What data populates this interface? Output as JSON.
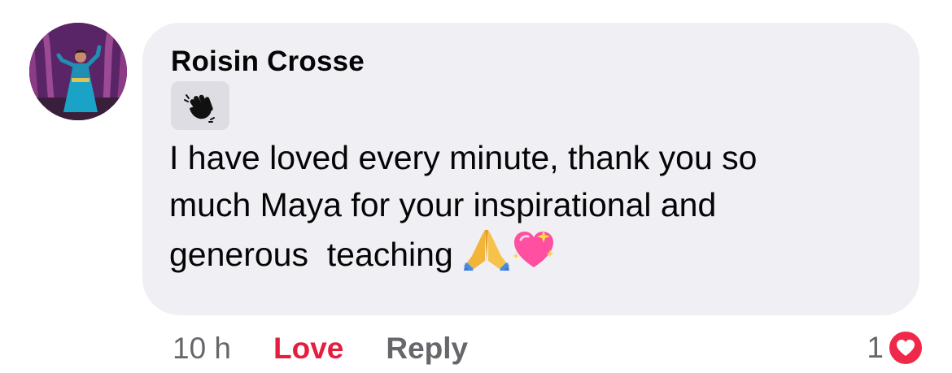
{
  "comment": {
    "author": "Roisin Crosse",
    "badge_icon": "waving-hand-icon",
    "text_lines": [
      "I have loved every minute, thank you so",
      "much Maya for your inspirational and",
      "generous  teaching"
    ],
    "emojis": [
      "folded-hands-icon",
      "sparkling-heart-icon"
    ]
  },
  "actions": {
    "timestamp": "10 h",
    "love_label": "Love",
    "reply_label": "Reply"
  },
  "reactions": {
    "count": "1",
    "icon": "love-reaction-icon"
  },
  "colors": {
    "bubble": "#efeff4",
    "love": "#e41e3f",
    "muted": "#65676b",
    "text": "#050505"
  }
}
